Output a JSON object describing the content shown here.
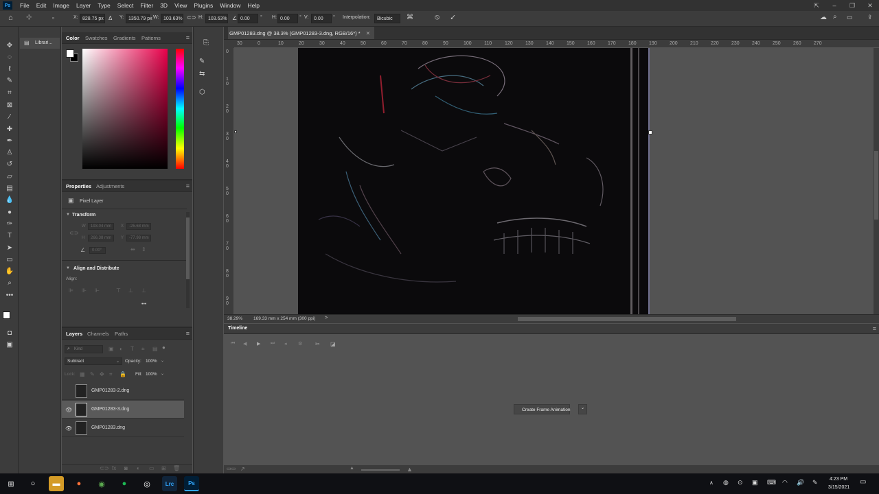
{
  "app": {
    "name": "Ps"
  },
  "menubar": {
    "items": [
      "File",
      "Edit",
      "Image",
      "Layer",
      "Type",
      "Select",
      "Filter",
      "3D",
      "View",
      "Plugins",
      "Window",
      "Help"
    ]
  },
  "options": {
    "x_label": "X:",
    "x_value": "828.75 px",
    "y_label": "Y:",
    "y_value": "1350.79 px",
    "w_label": "W:",
    "w_value": "103.63%",
    "h_label": "H:",
    "h_value": "103.63%",
    "angle_value": "0.00",
    "hskew_label": "H:",
    "hskew_value": "0.00",
    "vskew_label": "V:",
    "vskew_value": "0.00",
    "hskew_unit": "°",
    "vskew_unit": "°",
    "angle_unit": "°",
    "interp_label": "Interpolation:",
    "interp_value": "Bicubic"
  },
  "library": {
    "label": "Librari..."
  },
  "color_panel": {
    "tabs": [
      "Color",
      "Swatches",
      "Gradients",
      "Patterns"
    ]
  },
  "properties": {
    "tabs": [
      "Properties",
      "Adjustments"
    ],
    "pixel_layer": "Pixel Layer",
    "transform_title": "Transform",
    "w_label": "W",
    "w_value": "193.04 mm",
    "x_label": "X",
    "x_value": "-25.68 mm",
    "h_label": "H",
    "h_value": "266.38 mm",
    "y_label": "Y",
    "y_value": "-77.98 mm",
    "angle_value": "0.00°",
    "align_title": "Align and Distribute",
    "align_label": "Align:",
    "more": "•••"
  },
  "layers_panel": {
    "tabs": [
      "Layers",
      "Channels",
      "Paths"
    ],
    "kind_placeholder": "Kind",
    "blend_mode": "Subtract",
    "opacity_label": "Opacity:",
    "opacity_value": "100%",
    "lock_label": "Lock:",
    "fill_label": "Fill:",
    "fill_value": "100%",
    "layers": [
      {
        "name": "GMP01283-2.dng",
        "visible": false,
        "selected": false
      },
      {
        "name": "GMP01283-3.dng",
        "visible": true,
        "selected": true
      },
      {
        "name": "GMP01283.dng",
        "visible": true,
        "selected": false
      }
    ]
  },
  "document": {
    "tab_title": "GMP01283.dng @ 38.3% (GMP01283-3.dng, RGB/16*) *",
    "ruler_labels": [
      "30",
      "0",
      "10",
      "20",
      "30",
      "40",
      "50",
      "60",
      "70",
      "80",
      "90",
      "100",
      "110",
      "120",
      "130",
      "140",
      "150",
      "160",
      "170",
      "180",
      "190",
      "200",
      "210",
      "220",
      "230",
      "240",
      "250",
      "260",
      "270"
    ],
    "vruler_labels": [
      "0",
      "1 0",
      "2 0",
      "3 0",
      "4 0",
      "5 0",
      "6 0",
      "7 0",
      "8 0",
      "9 0"
    ]
  },
  "status": {
    "zoom": "38.29%",
    "doc_info": "169.33 mm x 254 mm (300 ppi)",
    "arrow": ">"
  },
  "timeline": {
    "title": "Timeline",
    "create_button": "Create Frame Animation"
  },
  "taskbar": {
    "time": "4:23 PM",
    "date": "3/15/2021",
    "lrc_label": "Lrc",
    "ps_label": "Ps"
  },
  "colors": {
    "app_dark": "#323232",
    "panel": "#3c3c3c",
    "canvas_bg": "#535353",
    "accent": "#31a8ff"
  }
}
